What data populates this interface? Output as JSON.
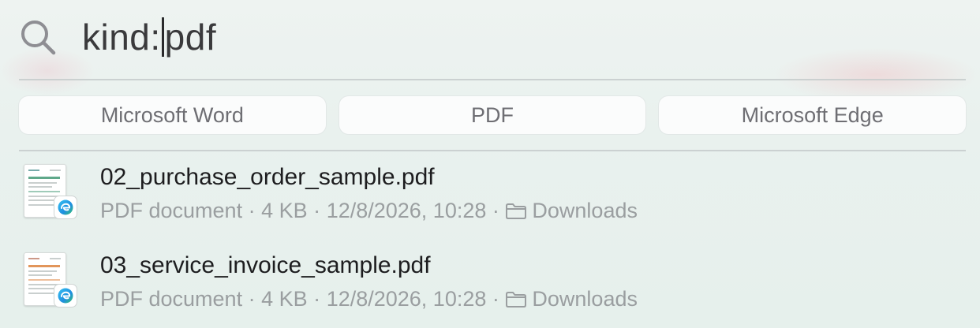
{
  "search": {
    "query_before_caret": "kind:",
    "query_after_caret": "pdf"
  },
  "chips": [
    {
      "label": "Microsoft Word"
    },
    {
      "label": "PDF"
    },
    {
      "label": "Microsoft Edge"
    }
  ],
  "results": [
    {
      "title": "02_purchase_order_sample.pdf",
      "kind": "PDF document",
      "size": "4 KB",
      "date": "12/8/2026, 10:28",
      "location": "Downloads",
      "sep": "·",
      "app_icon": "microsoft-edge-icon",
      "thumb_accent": "#5fa88a"
    },
    {
      "title": "03_service_invoice_sample.pdf",
      "kind": "PDF document",
      "size": "4 KB",
      "date": "12/8/2026, 10:28",
      "location": "Downloads",
      "sep": "·",
      "app_icon": "microsoft-edge-icon",
      "thumb_accent": "#e2955a"
    }
  ]
}
